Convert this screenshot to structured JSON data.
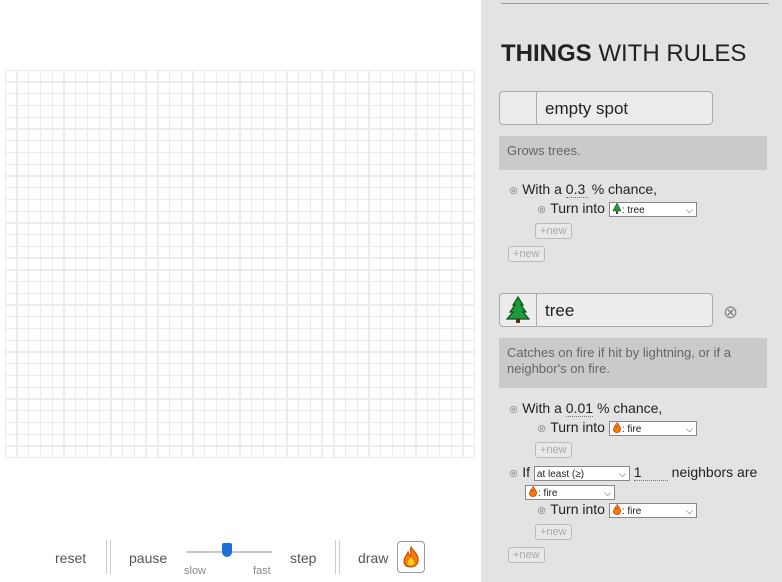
{
  "controls": {
    "reset": "reset",
    "pause": "pause",
    "slow": "slow",
    "fast": "fast",
    "step": "step",
    "draw": "draw",
    "speed_level": 0.5
  },
  "panel": {
    "title_bold": "THINGS",
    "title_rest": " WITH RULES",
    "things": [
      {
        "name": "empty spot",
        "description": "Grows trees.",
        "rules": [
          {
            "prefix": "With a",
            "value": "0.3",
            "suffix": "% chance,"
          },
          {
            "prefix": "Turn into",
            "select": ": tree"
          }
        ],
        "new_inner": "+new",
        "new_outer": "+new"
      },
      {
        "name": "tree",
        "description": "Catches on fire if hit by lightning, or if a neighbor's on fire.",
        "rules": [
          {
            "prefix": "With a",
            "value": "0.01",
            "suffix": "% chance,"
          },
          {
            "prefix": "Turn into",
            "select": ": fire"
          },
          {
            "prefix": "If",
            "select": "at least (≥)",
            "value": "1",
            "suffix": "neighbors are",
            "select2": ": fire"
          },
          {
            "prefix": "Turn into",
            "select": ": fire"
          }
        ],
        "new_inner1": "+new",
        "new_inner2": "+new",
        "new_outer": "+new"
      }
    ]
  },
  "colors": {
    "accent": "#1f6fd6",
    "panel_bg": "#e3e3e3",
    "desc_bg": "#cacaca"
  }
}
